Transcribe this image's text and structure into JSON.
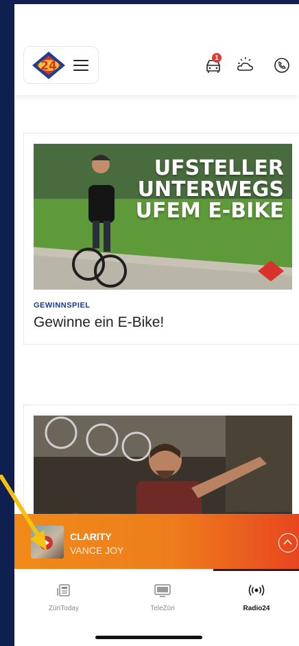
{
  "header": {
    "logo_text": "24",
    "notification_count": "1",
    "icons": [
      "car-icon",
      "weather-icon",
      "whatsapp-icon"
    ]
  },
  "articles": [
    {
      "tag": "GEWINNSPIEL",
      "title": "Gewinne ein E-Bike!",
      "image_lines": [
        "UFSTELLER",
        "UNTERWEGS",
        "UFEM E-BIKE"
      ]
    },
    {
      "tag": "",
      "title": ""
    }
  ],
  "player": {
    "track_title": "CLARITY",
    "artist": "VANCE JOY"
  },
  "tabs": [
    {
      "label": "ZüriToday",
      "icon": "newspaper-icon"
    },
    {
      "label": "TeleZüri",
      "icon": "tv-icon"
    },
    {
      "label": "Radio24",
      "icon": "radio-icon",
      "active": true
    }
  ],
  "colors": {
    "background": "#0f1f4f",
    "player_start": "#f0891a",
    "player_end": "#e8461f",
    "tag": "#1a3a8a",
    "badge": "#e53935"
  }
}
